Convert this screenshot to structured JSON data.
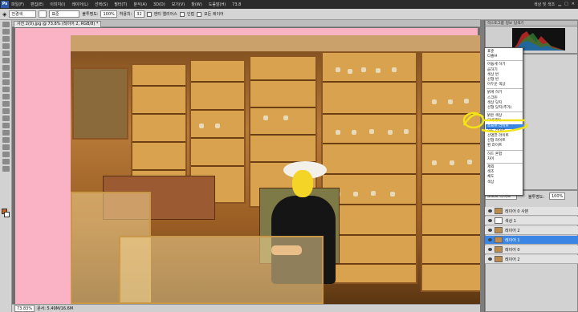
{
  "app": {
    "logo": "Ps",
    "menu": [
      "파일(F)",
      "편집(E)",
      "이미지(I)",
      "레이어(L)",
      "선택(S)",
      "필터(T)",
      "분석(A)",
      "3D(D)",
      "보기(V)",
      "창(W)",
      "도움말(H)"
    ],
    "zoom_menu": "73.8",
    "workspace": "색상 및 색조"
  },
  "options": {
    "style_value": "전경색",
    "mode_value": "표준",
    "opacity_label": "불투명도:",
    "opacity_value": "100%",
    "flow_label": "허용치:",
    "flow_value": "32",
    "antialias_label": "앤티 앨리어스",
    "contiguous_label": "인접",
    "all_layers_label": "모든 레이어"
  },
  "document": {
    "tab_title": "사진 2(0).jpg @ 73.8% (레이어 2, RGB/8) *",
    "status_zoom": "73.83%",
    "status_doc": "문서: 5.49M/16.6M"
  },
  "panels": {
    "histogram_tab": "히스토그램",
    "info_tab": "정보",
    "navigator_tab": "탐색기"
  },
  "blend_modes": [
    "표준",
    "디졸브",
    "어둡게 하기",
    "곱하기",
    "색상 번",
    "선형 번",
    "어두운 색상",
    "밝게 하기",
    "스크린",
    "색상 닷지",
    "선형 닷지(추가)",
    "밝은 색상",
    "오버레이",
    "소프트 라이트",
    "하드 라이트",
    "선명한 라이트",
    "선형 라이트",
    "핀 라이트",
    "하드 혼합",
    "차이",
    "제외",
    "색조",
    "채도",
    "색상",
    "광도"
  ],
  "blend_highlight_index": 13,
  "layers": {
    "blend_value": "소프트 라이트",
    "opacity_label": "불투명도:",
    "opacity_value": "100%",
    "rows": [
      {
        "name": "레이어 0 사본",
        "selected": false,
        "white": false
      },
      {
        "name": "색상 1",
        "selected": false,
        "white": true
      },
      {
        "name": "레이어 2",
        "selected": false,
        "white": false
      },
      {
        "name": "레이어 1",
        "selected": true,
        "white": false
      },
      {
        "name": "레이어 0",
        "selected": false,
        "white": false
      },
      {
        "name": "레이어 2",
        "selected": false,
        "white": false
      }
    ]
  },
  "colors": {
    "canvas_bg": "#f9b3c5",
    "highlight": "#3b86e5",
    "annotation": "#f2e21a",
    "foreground": "#c8641e"
  }
}
